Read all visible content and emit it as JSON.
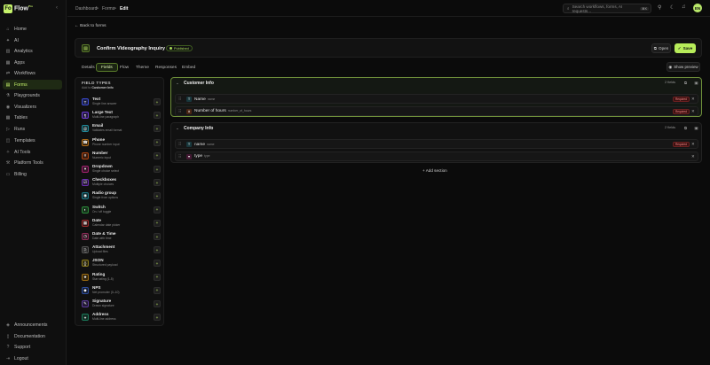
{
  "app": {
    "logo_letter": "Fo",
    "name": "Flow",
    "tier": "Pro"
  },
  "sidebar": {
    "items": [
      {
        "label": "Home",
        "icon": "home-icon",
        "glyph": "⌂"
      },
      {
        "label": "AI",
        "icon": "sparkle-icon",
        "glyph": "✦"
      },
      {
        "label": "Analytics",
        "icon": "chart-icon",
        "glyph": "▥"
      },
      {
        "label": "Apps",
        "icon": "grid-icon",
        "glyph": "▦"
      },
      {
        "label": "Workflows",
        "icon": "workflow-icon",
        "glyph": "⇄"
      },
      {
        "label": "Forms",
        "icon": "form-icon",
        "glyph": "▤"
      },
      {
        "label": "Playgrounds",
        "icon": "flask-icon",
        "glyph": "⚗"
      },
      {
        "label": "Visualizers",
        "icon": "eye-icon",
        "glyph": "◉"
      },
      {
        "label": "Tables",
        "icon": "table-icon",
        "glyph": "▦"
      },
      {
        "label": "Runs",
        "icon": "play-icon",
        "glyph": "▷"
      },
      {
        "label": "Templates",
        "icon": "template-icon",
        "glyph": "◫"
      },
      {
        "label": "AI Tools",
        "icon": "wrench-icon",
        "glyph": "✧"
      },
      {
        "label": "Platform Tools",
        "icon": "tools-icon",
        "glyph": "⚒"
      },
      {
        "label": "Billing",
        "icon": "card-icon",
        "glyph": "▭"
      }
    ],
    "bottom": [
      {
        "label": "Announcements",
        "icon": "megaphone-icon",
        "glyph": "◈"
      },
      {
        "label": "Documentation",
        "icon": "book-icon",
        "glyph": "▯"
      },
      {
        "label": "Support",
        "icon": "help-icon",
        "glyph": "?"
      },
      {
        "label": "Logout",
        "icon": "logout-icon",
        "glyph": "⇥"
      }
    ]
  },
  "breadcrumb": {
    "root": "Dashboard",
    "sep": ">",
    "mid": "Forms",
    "current": "Edit"
  },
  "search": {
    "placeholder": "Search workflows, forms, AI requests...",
    "shortcut": "⌘K"
  },
  "user": {
    "initials": "EN"
  },
  "page": {
    "back_label": "Back to forms",
    "form_title": "Confirm Videography Inquiry",
    "status": "Published",
    "open_label": "Open",
    "save_label": "Save",
    "preview_label": "Show preview"
  },
  "tabs": [
    "Details",
    "Fields",
    "Flow",
    "Theme",
    "Responses",
    "Embed"
  ],
  "field_types": {
    "title": "FIELD TYPES",
    "sub_prefix": "Add to",
    "sub_target": "Customer Info",
    "items": [
      {
        "name": "Text",
        "desc": "Single line answer",
        "color": "#3b4bd6",
        "glyph": "T"
      },
      {
        "name": "Large Text",
        "desc": "Multi-line paragraph",
        "color": "#6a3bd6",
        "glyph": "¶"
      },
      {
        "name": "Email",
        "desc": "Validates email format",
        "color": "#1f8a9a",
        "glyph": "@"
      },
      {
        "name": "Phone",
        "desc": "Phone number input",
        "color": "#b06a14",
        "glyph": "☎"
      },
      {
        "name": "Number",
        "desc": "Numeric input",
        "color": "#b0430f",
        "glyph": "#"
      },
      {
        "name": "Dropdown",
        "desc": "Single choice select",
        "color": "#a3206e",
        "glyph": "▾"
      },
      {
        "name": "Checkboxes",
        "desc": "Multiple choices",
        "color": "#6b2fb0",
        "glyph": "☑"
      },
      {
        "name": "Radio group",
        "desc": "Single from options",
        "color": "#1b7a8a",
        "glyph": "◉"
      },
      {
        "name": "Switch",
        "desc": "On / off toggle",
        "color": "#2a8a3a",
        "glyph": "◐"
      },
      {
        "name": "Date",
        "desc": "Calendar date picker",
        "color": "#9a2a2a",
        "glyph": "▦"
      },
      {
        "name": "Date & Time",
        "desc": "Date with time",
        "color": "#8a2a55",
        "glyph": "◷"
      },
      {
        "name": "Attachment",
        "desc": "Upload files",
        "color": "#555555",
        "glyph": "⎘"
      },
      {
        "name": "JSON",
        "desc": "Structured payload",
        "color": "#8a7a1a",
        "glyph": "{}"
      },
      {
        "name": "Rating",
        "desc": "Star rating (1-5)",
        "color": "#9a6a10",
        "glyph": "★"
      },
      {
        "name": "NPS",
        "desc": "Net promoter (0–10)",
        "color": "#2a4a9a",
        "glyph": "◆"
      },
      {
        "name": "Signature",
        "desc": "Drawn signature",
        "color": "#5a3a9a",
        "glyph": "✎"
      },
      {
        "name": "Address",
        "desc": "Multi-line address",
        "color": "#1a7a5a",
        "glyph": "⌖"
      }
    ]
  },
  "sections": [
    {
      "title": "Customer Info",
      "count": "2 fields",
      "fields": [
        {
          "label": "Name",
          "key": "name",
          "required": "Required",
          "color": "#1f7a8a",
          "glyph": "T"
        },
        {
          "label": "Number of hours",
          "key": "number_of_hours",
          "required": "Required",
          "color": "#b0430f",
          "glyph": "#"
        }
      ]
    },
    {
      "title": "Company Info",
      "count": "2 fields",
      "fields": [
        {
          "label": "name",
          "key": "name",
          "required": "Required",
          "color": "#1f7a8a",
          "glyph": "T"
        },
        {
          "label": "type",
          "key": "type",
          "required": "",
          "color": "#a3206e",
          "glyph": "▾"
        }
      ]
    }
  ],
  "add_section_label": "+ Add section",
  "colors": {
    "accent": "#c6f36b",
    "bg": "#0b0b0b",
    "required": "#ff8a8a"
  }
}
